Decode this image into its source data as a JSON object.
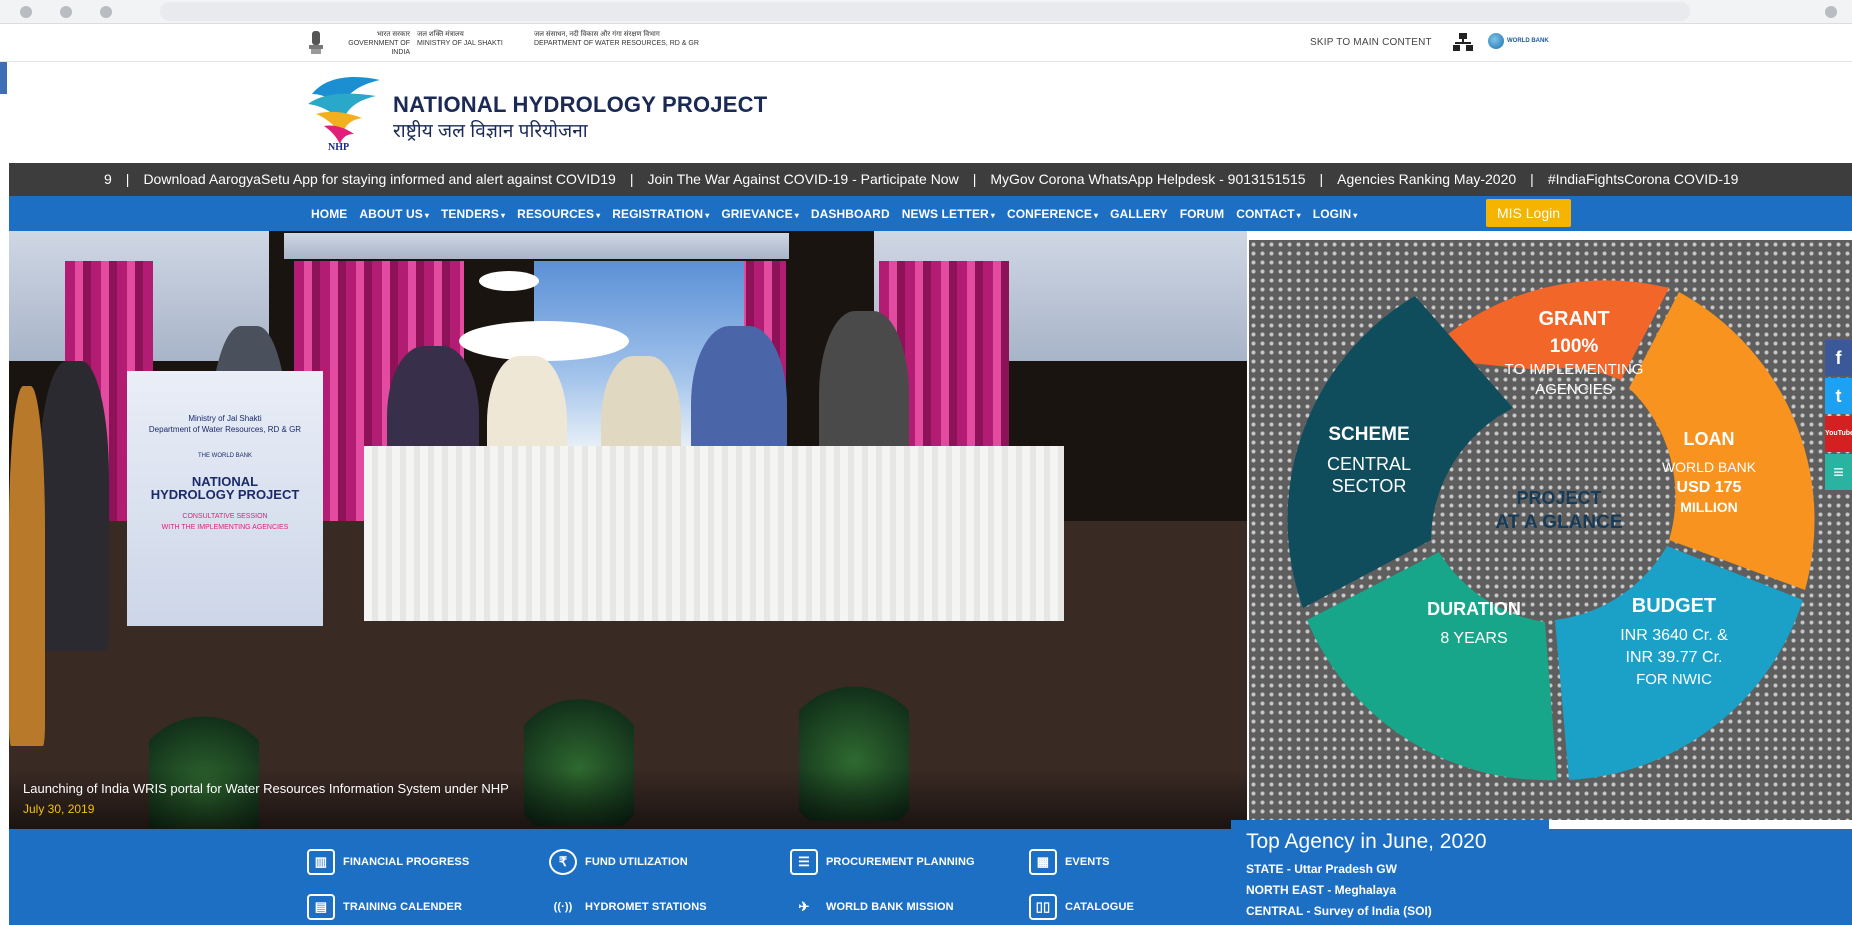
{
  "gov_header": {
    "items": [
      {
        "hi": "भारत सरकार",
        "en": "GOVERNMENT OF INDIA"
      },
      {
        "hi": "जल शक्ति मंत्रालय",
        "en": "MINISTRY OF JAL SHAKTI"
      },
      {
        "hi": "जल संसाधन, नदी विकास और गंगा संरक्षण विभाग",
        "en": "DEPARTMENT OF WATER RESOURCES, RD & GR"
      }
    ],
    "skip_link": "SKIP TO MAIN CONTENT",
    "world_bank": "WORLD BANK"
  },
  "site": {
    "title": "NATIONAL HYDROLOGY PROJECT",
    "subtitle": "राष्ट्रीय जल विज्ञान परियोजना",
    "logo_text": "NHP"
  },
  "ticker": {
    "items": [
      "9",
      "Download AarogyaSetu App for staying informed and alert against COVID19",
      "Join The War Against COVID-19 - Participate Now",
      "MyGov Corona WhatsApp Helpdesk - 9013151515",
      "Agencies Ranking May-2020",
      "#IndiaFightsCorona COVID-19"
    ]
  },
  "nav": {
    "items": [
      {
        "label": "HOME",
        "dropdown": false
      },
      {
        "label": "ABOUT US",
        "dropdown": true
      },
      {
        "label": "TENDERS",
        "dropdown": true
      },
      {
        "label": "RESOURCES",
        "dropdown": true
      },
      {
        "label": "REGISTRATION",
        "dropdown": true
      },
      {
        "label": "GRIEVANCE",
        "dropdown": true
      },
      {
        "label": "DASHBOARD",
        "dropdown": false
      },
      {
        "label": "NEWS LETTER",
        "dropdown": true
      },
      {
        "label": "CONFERENCE",
        "dropdown": true
      },
      {
        "label": "GALLERY",
        "dropdown": false
      },
      {
        "label": "FORUM",
        "dropdown": false
      },
      {
        "label": "CONTACT",
        "dropdown": true
      },
      {
        "label": "LOGIN",
        "dropdown": true
      }
    ],
    "mis_login": "MIS Login",
    "caret": "▾"
  },
  "slide": {
    "caption": "Launching of India WRIS portal for Water Resources Information System under NHP",
    "date": "July 30, 2019",
    "podium_lines": [
      "Ministry of Jal Shakti",
      "Department of Water Resources, RD & GR",
      "THE WORLD BANK",
      "NATIONAL",
      "HYDROLOGY PROJECT",
      "CONSULTATIVE SESSION",
      "WITH THE IMPLEMENTING AGENCIES"
    ]
  },
  "glance": {
    "center": [
      "PROJECT",
      "AT A GLANCE"
    ],
    "grant": {
      "head": "GRANT",
      "value": "100%",
      "l1": "TO IMPLEMENTING",
      "l2": "AGENCIES"
    },
    "loan": {
      "head": "LOAN",
      "l1": "WORLD BANK",
      "l2": "USD 175",
      "l3": "MILLION"
    },
    "budget": {
      "head": "BUDGET",
      "l1": "INR 3640 Cr. &",
      "l2": "INR 39.77 Cr.",
      "l3": "FOR NWIC"
    },
    "duration": {
      "head": "DURATION",
      "value": "8 YEARS"
    },
    "scheme": {
      "head": "SCHEME",
      "l1": "CENTRAL",
      "l2": "SECTOR"
    },
    "colors": {
      "grant": "#f2662a",
      "loan": "#f7931e",
      "budget": "#1ba1c8",
      "duration": "#17a689",
      "scheme": "#0f4c5c"
    }
  },
  "social": [
    "f",
    "t",
    "YouTube",
    "≡"
  ],
  "quick_links": [
    {
      "label": "FINANCIAL PROGRESS",
      "icon": "▥"
    },
    {
      "label": "FUND UTILIZATION",
      "icon": "₹"
    },
    {
      "label": "PROCUREMENT PLANNING",
      "icon": "☰"
    },
    {
      "label": "EVENTS",
      "icon": "▦"
    },
    {
      "label": "TRAINING CALENDER",
      "icon": "▤"
    },
    {
      "label": "HYDROMET STATIONS",
      "icon": "((·))"
    },
    {
      "label": "WORLD BANK MISSION",
      "icon": "✈"
    },
    {
      "label": "CATALOGUE",
      "icon": "▯▯"
    }
  ],
  "top_agency": {
    "title": "Top Agency in June, 2020",
    "lines": [
      "STATE - Uttar Pradesh GW",
      "NORTH EAST - Meghalaya",
      "CENTRAL - Survey of India (SOI)"
    ]
  }
}
